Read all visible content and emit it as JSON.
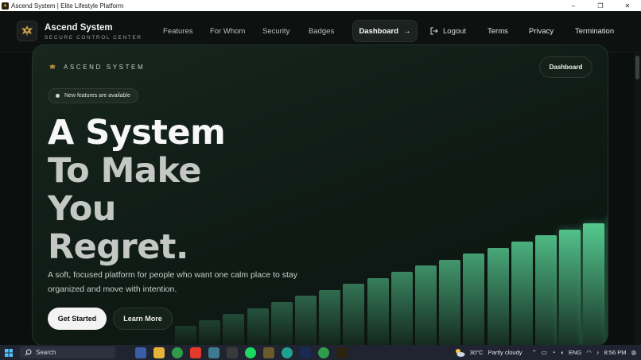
{
  "window": {
    "title": "Ascend System | Elite Lifestyle Platform",
    "controls": {
      "minimize": "–",
      "maximize": "❐",
      "close": "✕"
    }
  },
  "header": {
    "brand_name": "Ascend System",
    "brand_subtitle": "SECURE CONTROL CENTER",
    "nav": [
      {
        "label": "Features"
      },
      {
        "label": "For Whom"
      },
      {
        "label": "Security"
      },
      {
        "label": "Badges"
      }
    ],
    "dashboard_label": "Dashboard",
    "dashboard_arrow": "→",
    "logout_label": "Logout",
    "right_nav": [
      {
        "label": "Terms"
      },
      {
        "label": "Privacy"
      },
      {
        "label": "Termination"
      }
    ]
  },
  "hero": {
    "card_brand": "ASCEND SYSTEM",
    "card_dashboard_label": "Dashboard",
    "pill_text": "New features are available",
    "headline": [
      "A System",
      "To Make",
      "You",
      "Regret."
    ],
    "lead": "A soft, focused platform for people who want one calm place to stay organized and move with intention.",
    "primary_cta": "Get Started",
    "secondary_cta": "Learn More"
  },
  "decor_bars": {
    "levels": [
      0.14,
      0.18,
      0.22,
      0.26,
      0.3,
      0.34,
      0.38,
      0.42,
      0.46,
      0.5,
      0.54,
      0.58,
      0.62,
      0.66,
      0.7,
      0.74,
      0.78,
      0.82,
      0.86,
      0.91,
      0.96
    ],
    "color_from": "#1c3a2c",
    "color_to": "#5fe3a1"
  },
  "taskbar": {
    "search_placeholder": "Search",
    "temperature": "30°C",
    "weather": "Partly cloudy",
    "language": "ENG",
    "time": "8:56 PM"
  },
  "colors": {
    "background": "#0b0f0d",
    "card": "#0f1a15",
    "accent": "#5fe3a1"
  }
}
